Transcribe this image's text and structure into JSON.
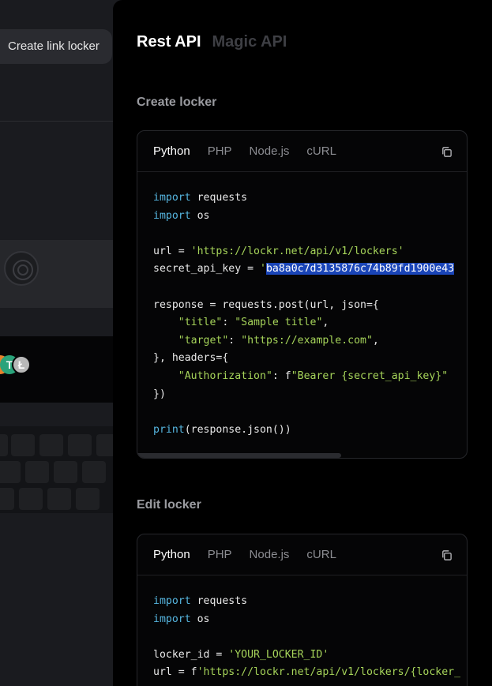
{
  "background_app": {
    "create_link_locker_label": "Create link locker"
  },
  "api_tabs": [
    {
      "label": "Rest API",
      "active": true
    },
    {
      "label": "Magic API",
      "active": false
    }
  ],
  "sections": [
    {
      "title": "Create locker",
      "language_tabs": [
        "Python",
        "PHP",
        "Node.js",
        "cURL"
      ],
      "active_language": "Python",
      "code_lines": [
        "import requests",
        "import os",
        "",
        "url = 'https://lockr.net/api/v1/lockers'",
        "secret_api_key = 'ba8a0c7d3135876c74b89fd1900e43",
        "",
        "response = requests.post(url, json={",
        "    \"title\": \"Sample title\",",
        "    \"target\": \"https://example.com\",",
        "}, headers={",
        "    \"Authorization\": f\"Bearer {secret_api_key}\"",
        "})",
        "",
        "print(response.json())"
      ]
    },
    {
      "title": "Edit locker",
      "language_tabs": [
        "Python",
        "PHP",
        "Node.js",
        "cURL"
      ],
      "active_language": "Python",
      "code_lines": [
        "import requests",
        "import os",
        "",
        "locker_id = 'YOUR_LOCKER_ID'",
        "url = f'https://lockr.net/api/v1/lockers/{locker_"
      ]
    }
  ],
  "colors": {
    "panel_bg": "#000000",
    "keyword": "#56b6e0",
    "string": "#a6d45a",
    "selection": "#1a45b8"
  }
}
